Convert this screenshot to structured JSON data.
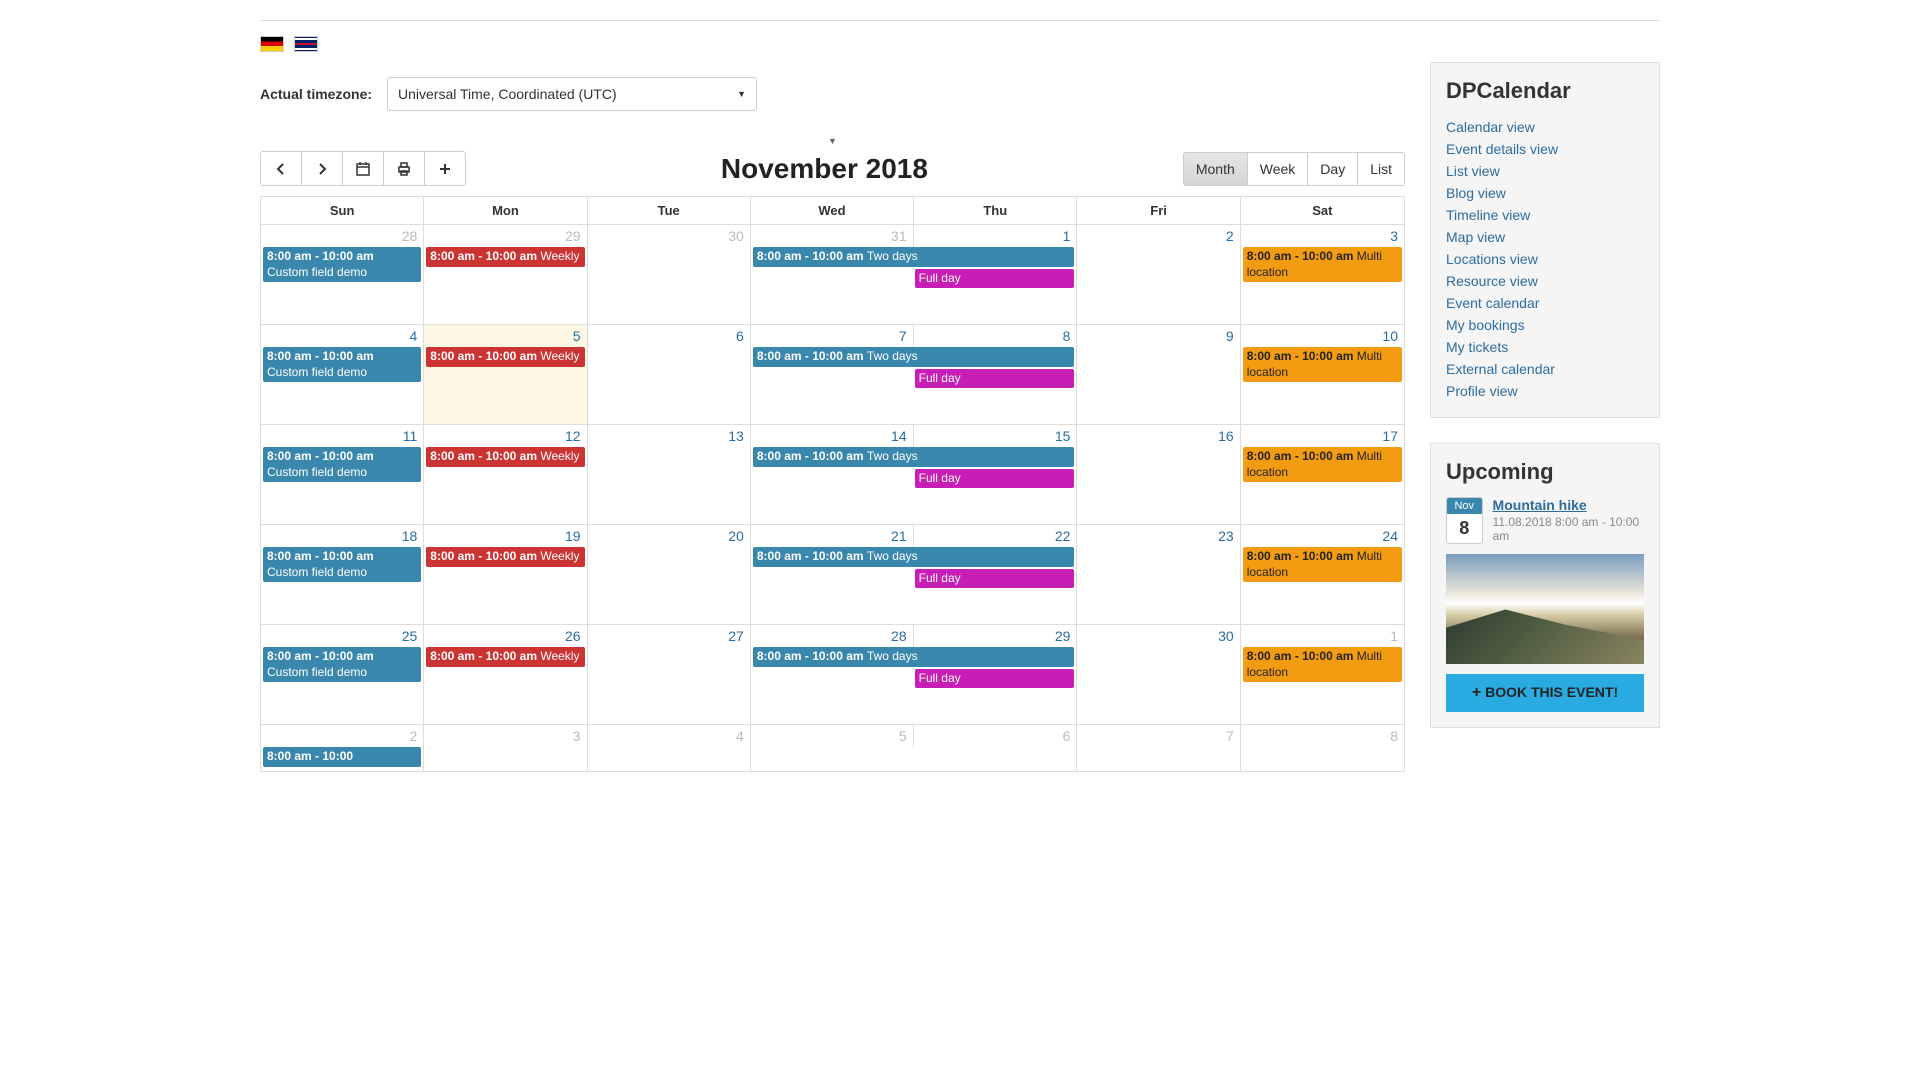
{
  "timezone": {
    "label": "Actual timezone:",
    "value": "Universal Time, Coordinated (UTC)"
  },
  "calendar": {
    "title": "November 2018",
    "views": {
      "month": "Month",
      "week": "Week",
      "day": "Day",
      "list": "List"
    },
    "dayHeaders": [
      "Sun",
      "Mon",
      "Tue",
      "Wed",
      "Thu",
      "Fri",
      "Sat"
    ],
    "weeks": [
      {
        "wedThu": {
          "wed": "31",
          "thu": "1",
          "wedOther": true
        },
        "days": [
          {
            "num": "28",
            "other": true,
            "events": [
              {
                "color": "blue",
                "time": "8:00 am - 10:00 am",
                "title": "Custom field demo"
              }
            ]
          },
          {
            "num": "29",
            "other": true,
            "events": [
              {
                "color": "red",
                "time": "8:00 am - 10:00 am",
                "title": "Weekly"
              }
            ]
          },
          {
            "num": "30",
            "other": true,
            "events": []
          },
          {
            "num": "2",
            "events": []
          },
          {
            "num": "3",
            "events": [
              {
                "color": "orange",
                "time": "8:00 am - 10:00 am",
                "title": "Multi location"
              }
            ]
          }
        ],
        "span": {
          "time": "8:00 am - 10:00 am",
          "title": "Two days"
        },
        "fullday": "Full day"
      },
      {
        "wedThu": {
          "wed": "7",
          "thu": "8"
        },
        "days": [
          {
            "num": "4",
            "events": [
              {
                "color": "blue",
                "time": "8:00 am - 10:00 am",
                "title": "Custom field demo"
              }
            ]
          },
          {
            "num": "5",
            "today": true,
            "events": [
              {
                "color": "red",
                "time": "8:00 am - 10:00 am",
                "title": "Weekly"
              }
            ]
          },
          {
            "num": "6",
            "events": []
          },
          {
            "num": "9",
            "events": []
          },
          {
            "num": "10",
            "events": [
              {
                "color": "orange",
                "time": "8:00 am - 10:00 am",
                "title": "Multi location"
              }
            ]
          }
        ],
        "span": {
          "time": "8:00 am - 10:00 am",
          "title": "Two days"
        },
        "fullday": "Full day"
      },
      {
        "wedThu": {
          "wed": "14",
          "thu": "15"
        },
        "days": [
          {
            "num": "11",
            "events": [
              {
                "color": "blue",
                "time": "8:00 am - 10:00 am",
                "title": "Custom field demo"
              }
            ]
          },
          {
            "num": "12",
            "events": [
              {
                "color": "red",
                "time": "8:00 am - 10:00 am",
                "title": "Weekly"
              }
            ]
          },
          {
            "num": "13",
            "events": []
          },
          {
            "num": "16",
            "events": []
          },
          {
            "num": "17",
            "events": [
              {
                "color": "orange",
                "time": "8:00 am - 10:00 am",
                "title": "Multi location"
              }
            ]
          }
        ],
        "span": {
          "time": "8:00 am - 10:00 am",
          "title": "Two days"
        },
        "fullday": "Full day"
      },
      {
        "wedThu": {
          "wed": "21",
          "thu": "22"
        },
        "days": [
          {
            "num": "18",
            "events": [
              {
                "color": "blue",
                "time": "8:00 am - 10:00 am",
                "title": "Custom field demo"
              }
            ]
          },
          {
            "num": "19",
            "events": [
              {
                "color": "red",
                "time": "8:00 am - 10:00 am",
                "title": "Weekly"
              }
            ]
          },
          {
            "num": "20",
            "events": []
          },
          {
            "num": "23",
            "events": []
          },
          {
            "num": "24",
            "events": [
              {
                "color": "orange",
                "time": "8:00 am - 10:00 am",
                "title": "Multi location"
              }
            ]
          }
        ],
        "span": {
          "time": "8:00 am - 10:00 am",
          "title": "Two days"
        },
        "fullday": "Full day"
      },
      {
        "wedThu": {
          "wed": "28",
          "thu": "29"
        },
        "days": [
          {
            "num": "25",
            "events": [
              {
                "color": "blue",
                "time": "8:00 am - 10:00 am",
                "title": "Custom field demo"
              }
            ]
          },
          {
            "num": "26",
            "events": [
              {
                "color": "red",
                "time": "8:00 am - 10:00 am",
                "title": "Weekly"
              }
            ]
          },
          {
            "num": "27",
            "events": []
          },
          {
            "num": "30",
            "events": []
          },
          {
            "num": "1",
            "other": true,
            "events": [
              {
                "color": "orange",
                "time": "8:00 am - 10:00 am",
                "title": "Multi location"
              }
            ]
          }
        ],
        "span": {
          "time": "8:00 am - 10:00 am",
          "title": "Two days"
        },
        "fullday": "Full day"
      },
      {
        "wedThu": {
          "wed": "5",
          "thu": "6",
          "allOther": true
        },
        "days": [
          {
            "num": "2",
            "other": true,
            "events": [
              {
                "color": "blue",
                "time": "8:00 am - 10:00",
                "title": ""
              }
            ]
          },
          {
            "num": "3",
            "other": true,
            "events": []
          },
          {
            "num": "4",
            "other": true,
            "events": []
          },
          {
            "num": "7",
            "other": true,
            "events": []
          },
          {
            "num": "8",
            "other": true,
            "events": []
          }
        ]
      }
    ]
  },
  "sidebar": {
    "title": "DPCalendar",
    "links": [
      "Calendar view",
      "Event details view",
      "List view",
      "Blog view",
      "Timeline view",
      "Map view",
      "Locations view",
      "Resource view",
      "Event calendar",
      "My bookings",
      "My tickets",
      "External calendar",
      "Profile view"
    ]
  },
  "upcoming": {
    "heading": "Upcoming",
    "badgeMonth": "Nov",
    "badgeDay": "8",
    "title": "Mountain hike",
    "datetime": "11.08.2018 8:00 am - 10:00 am",
    "bookLabel": "BOOK THIS EVENT!"
  }
}
